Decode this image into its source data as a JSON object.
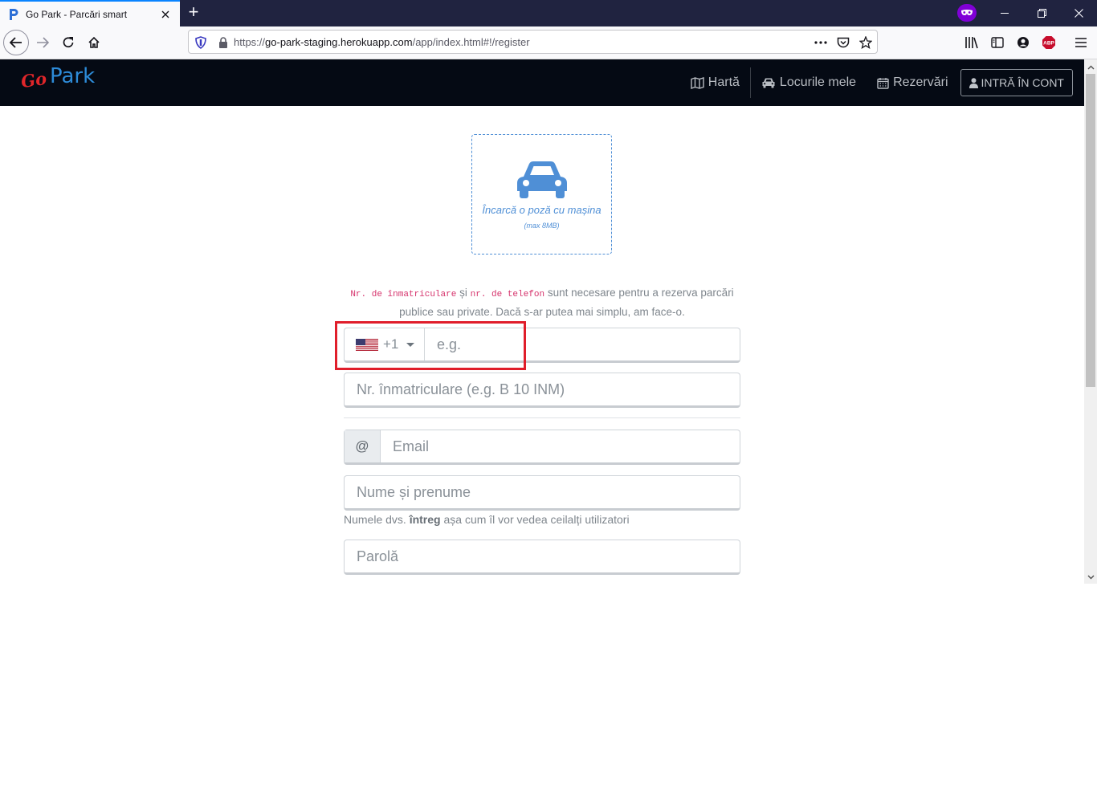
{
  "browser": {
    "tab_title": "Go Park - Parcări smart",
    "url_scheme": "https://",
    "url_host": "go-park-staging.herokuapp.com",
    "url_path": "/app/index.html#!/register",
    "new_tab_label": "+"
  },
  "header": {
    "logo_go": "Go",
    "logo_park": "Park",
    "menu": {
      "map": "Hartă",
      "my_places": "Locurile mele",
      "bookings": "Rezervări",
      "login": "INTRĂ ÎN CONT"
    }
  },
  "upload": {
    "label": "Încarcă o poză cu mașina",
    "hint": "(max 8MB)"
  },
  "info": {
    "code_plate": "Nr. de înmatriculare",
    "and": "și",
    "code_phone": "nr. de telefon",
    "text": "sunt necesare pentru a rezerva parcări publice sau private. Dacă s-ar putea mai simplu, am face-o."
  },
  "form": {
    "phone_code": "+1",
    "phone_placeholder": "e.g.",
    "plate_placeholder": "Nr. înmatriculare (e.g. B 10 INM)",
    "email_addon": "@",
    "email_placeholder": "Email",
    "name_placeholder": "Nume și prenume",
    "name_help_prefix": "Numele dvs.",
    "name_help_bold": "întreg",
    "name_help_suffix": "așa cum îl vor vedea ceilalți utilizatori",
    "password_placeholder": "Parolă"
  },
  "colors": {
    "header_bg": "#050a14",
    "accent_blue": "#4f8fd6",
    "highlight_red": "#e01e2b",
    "code_pink": "#d6336c"
  }
}
